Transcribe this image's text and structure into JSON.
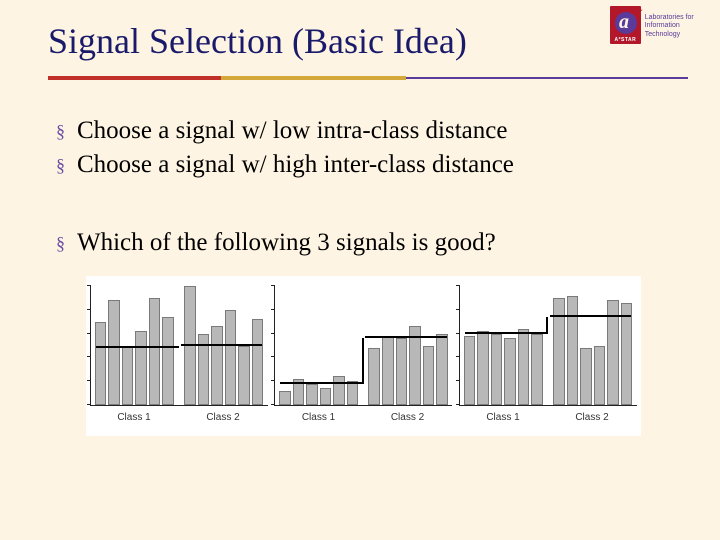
{
  "title": "Signal Selection (Basic Idea)",
  "logo": {
    "letter": "a",
    "astar": "A*STAR",
    "text_line1": "Laboratories for",
    "text_line2": "Information Technology"
  },
  "bullets_group1": [
    "Choose a signal w/ low intra-class distance",
    "Choose a signal w/ high inter-class distance"
  ],
  "bullets_group2": [
    "Which of the following 3 signals is good?"
  ],
  "chart_data": [
    {
      "type": "bar",
      "title": "",
      "xlabel": "",
      "ylabel": "",
      "ylim": [
        0,
        100
      ],
      "class1_label": "Class 1",
      "class2_label": "Class 2",
      "series": [
        {
          "name": "Class 1",
          "values": [
            70,
            88,
            50,
            62,
            90,
            74
          ]
        },
        {
          "name": "Class 2",
          "values": [
            100,
            60,
            66,
            80,
            50,
            72
          ]
        }
      ],
      "mean_lines": {
        "class1": 48,
        "class2": 50
      }
    },
    {
      "type": "bar",
      "title": "",
      "xlabel": "",
      "ylabel": "",
      "ylim": [
        0,
        100
      ],
      "class1_label": "Class 1",
      "class2_label": "Class 2",
      "series": [
        {
          "name": "Class 1",
          "values": [
            12,
            22,
            18,
            14,
            24,
            20
          ]
        },
        {
          "name": "Class 2",
          "values": [
            48,
            58,
            56,
            66,
            50,
            60
          ]
        }
      ],
      "mean_lines": {
        "class1": 18,
        "class2": 56
      }
    },
    {
      "type": "bar",
      "title": "",
      "xlabel": "",
      "ylabel": "",
      "ylim": [
        0,
        100
      ],
      "class1_label": "Class 1",
      "class2_label": "Class 2",
      "series": [
        {
          "name": "Class 1",
          "values": [
            58,
            62,
            60,
            56,
            64,
            60
          ]
        },
        {
          "name": "Class 2",
          "values": [
            90,
            92,
            48,
            50,
            88,
            86
          ]
        }
      ],
      "mean_lines": {
        "class1": 60,
        "class2": 74
      }
    }
  ]
}
